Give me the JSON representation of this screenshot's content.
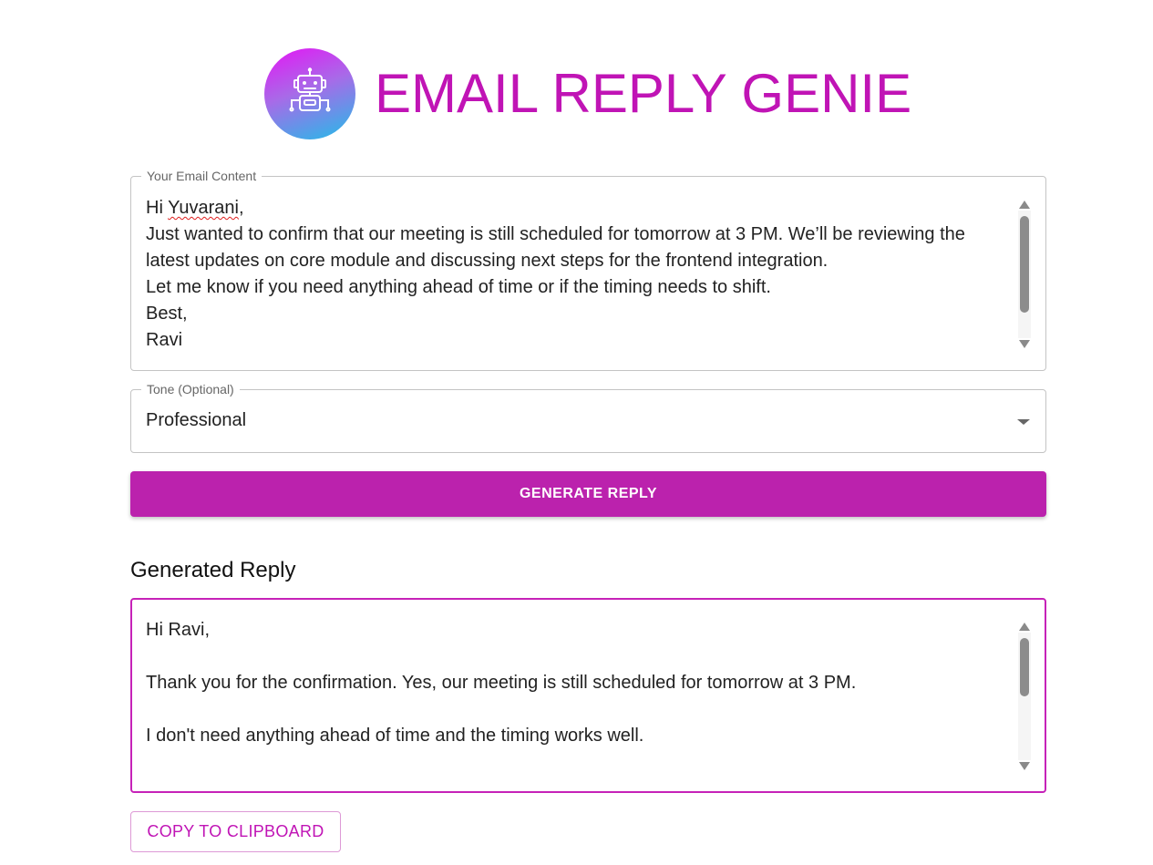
{
  "app": {
    "title": "EMAIL REPLY GENIE",
    "logo_icon": "robot-icon",
    "accent_color": "#bb22ad"
  },
  "email_input": {
    "label": "Your Email Content",
    "greeting_prefix": "Hi ",
    "greeting_name": "Yuvarani",
    "greeting_suffix": ",",
    "body": "Just wanted to confirm that our meeting is still scheduled for tomorrow at 3 PM. We’ll be reviewing the latest updates on core module and discussing next steps for the frontend integration.\nLet me know if you need anything ahead of time or if the timing needs to shift.\nBest,\nRavi"
  },
  "tone": {
    "label": "Tone (Optional)",
    "selected": "Professional"
  },
  "generate_button": {
    "label": "GENERATE REPLY"
  },
  "reply": {
    "heading": "Generated Reply",
    "text": "Hi Ravi,\n\nThank you for the confirmation. Yes, our meeting is still scheduled for tomorrow at 3 PM.\n\nI don't need anything ahead of time and the timing works well."
  },
  "copy_button": {
    "label": "COPY TO CLIPBOARD"
  }
}
